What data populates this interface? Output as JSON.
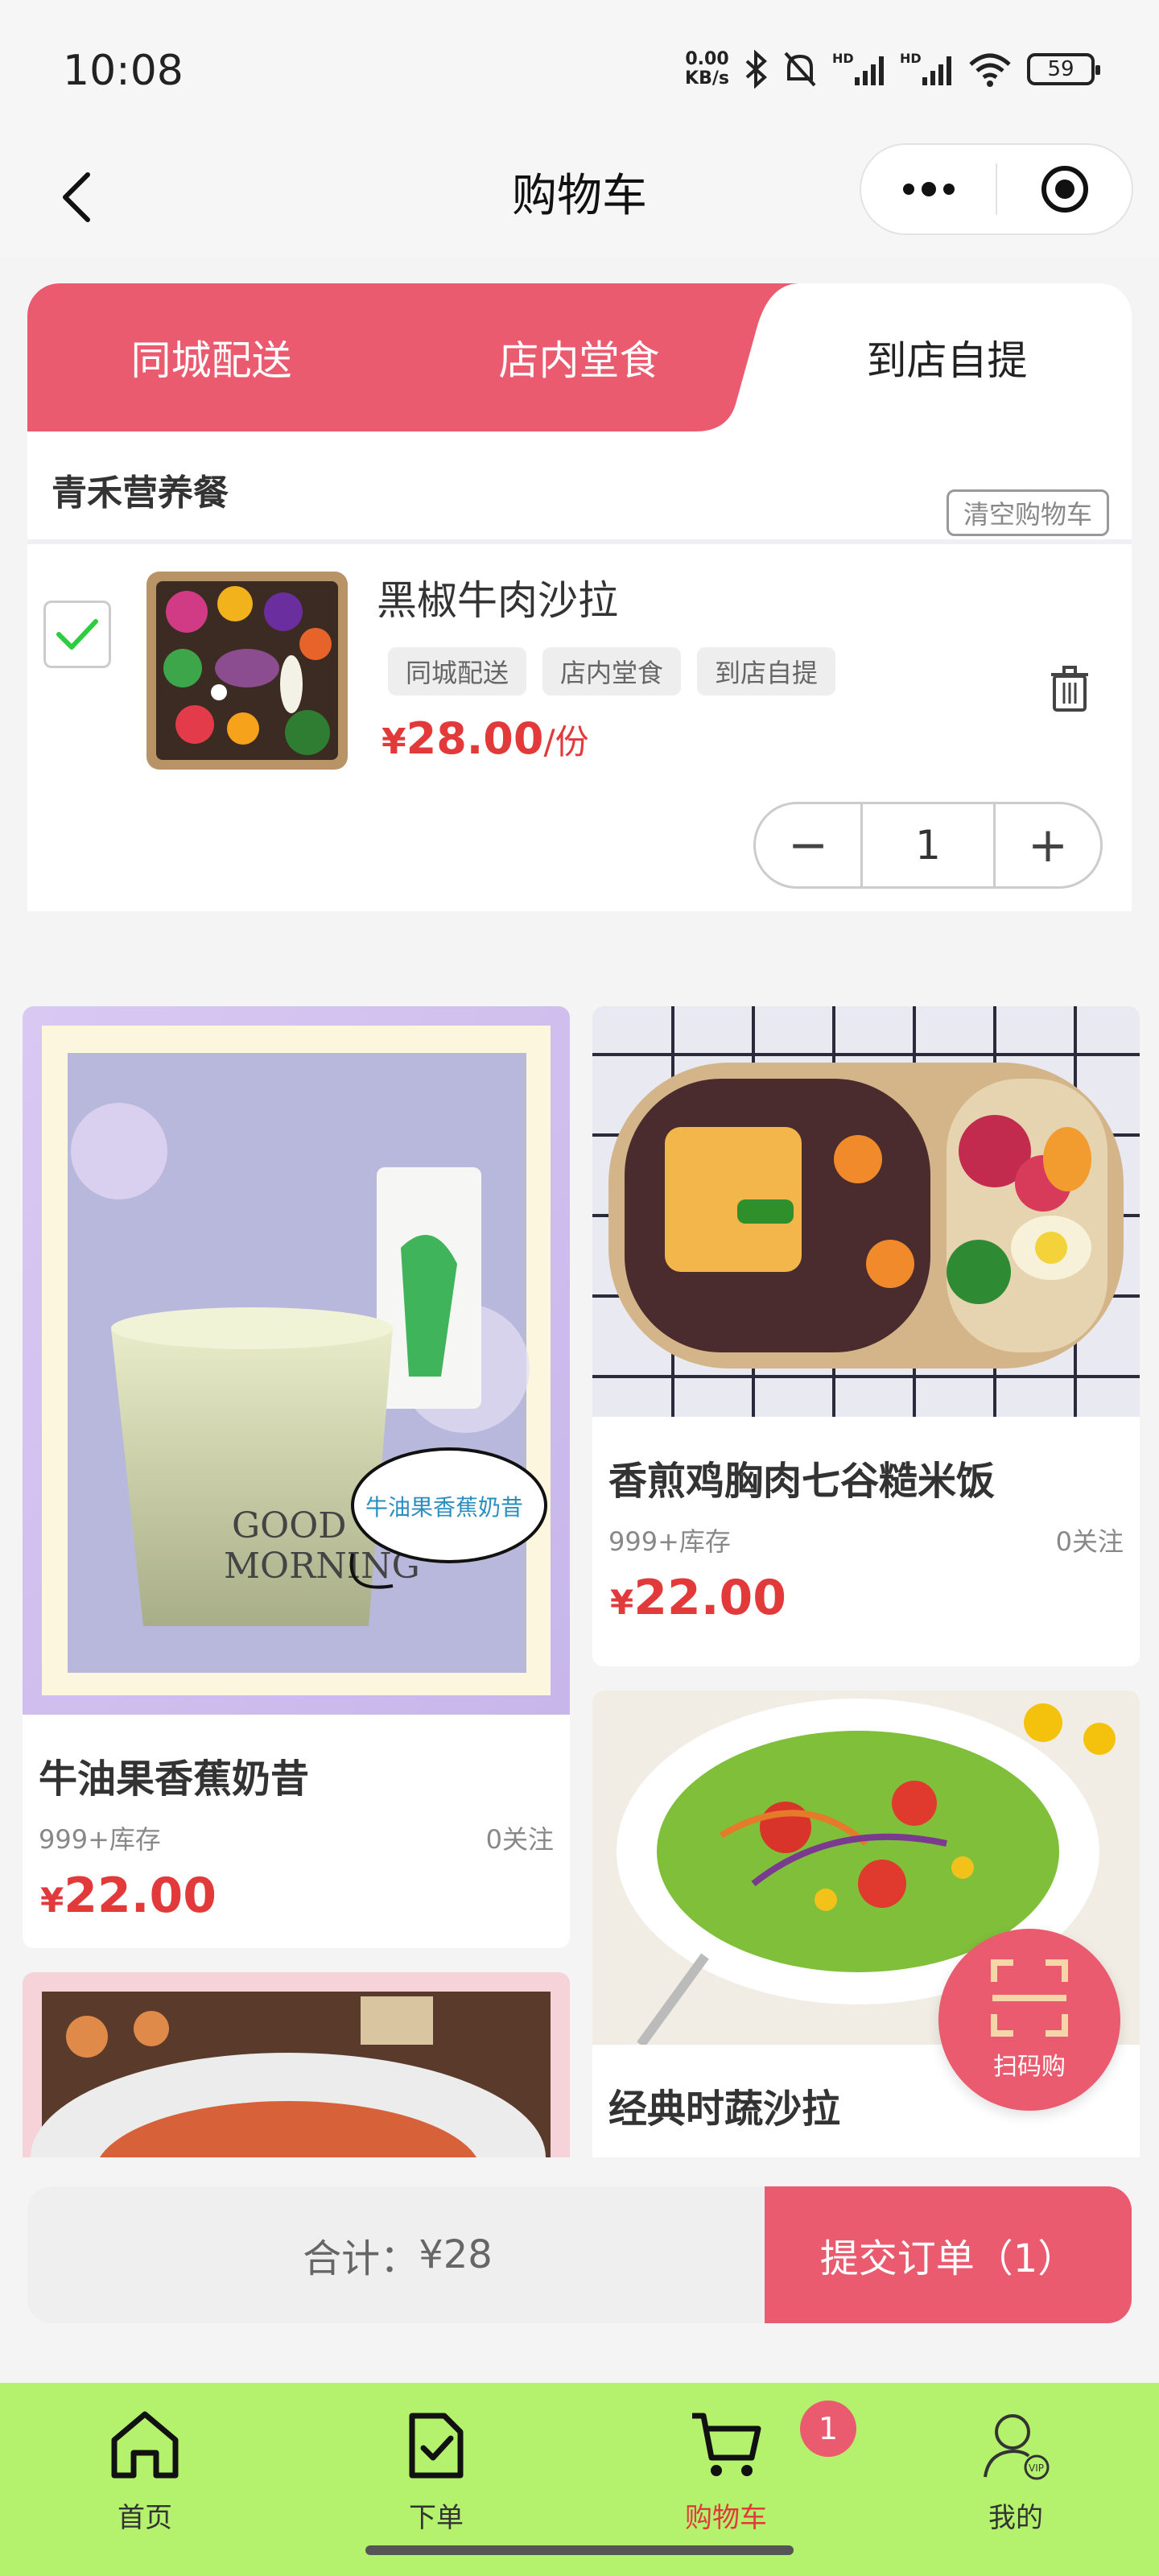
{
  "status_bar": {
    "time": "10:08",
    "net_speed_value": "0.00",
    "net_speed_unit": "KB/s",
    "battery": "59",
    "icons": [
      "bluetooth-icon",
      "mute-icon",
      "hd-signal-icon",
      "hd-signal-icon",
      "wifi-icon",
      "battery-icon"
    ]
  },
  "nav": {
    "title": "购物车",
    "back_icon": "chevron-left-icon",
    "more_icon": "more-dots-icon",
    "close_icon": "target-circle-icon"
  },
  "delivery_tabs": [
    {
      "label": "同城配送",
      "active": false
    },
    {
      "label": "店内堂食",
      "active": false
    },
    {
      "label": "到店自提",
      "active": true
    }
  ],
  "store": {
    "name": "青禾营养餐",
    "clear_label": "清空购物车"
  },
  "cart_item": {
    "name": "黑椒牛肉沙拉",
    "checked": true,
    "tags": [
      "同城配送",
      "店内堂食",
      "到店自提"
    ],
    "currency": "¥",
    "price": "28.00",
    "unit": "/份",
    "quantity": "1",
    "minus": "−",
    "plus": "+"
  },
  "products": [
    {
      "title": "牛油果香蕉奶昔",
      "stock": "999+库存",
      "follow": "0关注",
      "currency": "¥",
      "price": "22.00",
      "image_text": "牛油果香蕉奶昔",
      "image_word1": "GOOD",
      "image_word2": "MORNING"
    },
    {
      "title": "香煎鸡胸肉七谷糙米饭",
      "stock": "999+库存",
      "follow": "0关注",
      "currency": "¥",
      "price": "22.00"
    },
    {
      "title": "经典时蔬沙拉"
    },
    {
      "title": ""
    }
  ],
  "scan_button": {
    "label": "扫码购",
    "icon": "scan-icon"
  },
  "checkout": {
    "total_label": "合计：",
    "total_value": "¥28",
    "submit_label": "提交订单（1）"
  },
  "tabbar": {
    "items": [
      {
        "label": "首页",
        "icon": "home-icon",
        "active": false
      },
      {
        "label": "下单",
        "icon": "order-check-icon",
        "active": false
      },
      {
        "label": "购物车",
        "icon": "cart-icon",
        "active": true,
        "badge": "1"
      },
      {
        "label": "我的",
        "icon": "user-vip-icon",
        "active": false
      }
    ]
  },
  "colors": {
    "accent": "#ea5b6f",
    "price": "#e23a3a",
    "tabbar_bg": "#b4f26e",
    "check": "#2ecc40"
  }
}
